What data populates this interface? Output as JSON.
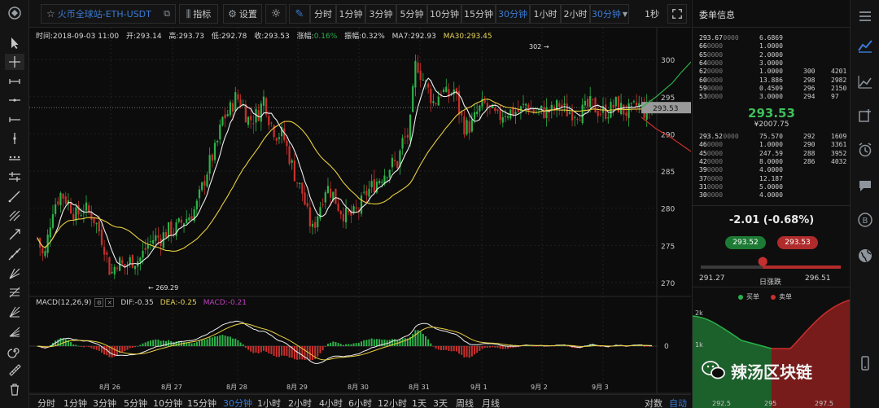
{
  "symbol": {
    "label": "火币全球站-ETH-USDT"
  },
  "toolbar": {
    "indicators": "指标",
    "settings": "设置",
    "timeframes": [
      "分时",
      "1分钟",
      "3分钟",
      "5分钟",
      "10分钟",
      "15分钟",
      "30分钟",
      "1小时",
      "2小时"
    ],
    "active_timeframe": "30分钟",
    "dropdown_value": "30分钟",
    "refresh": "1秒"
  },
  "info": {
    "time": "时间:2018-09-03 11:00",
    "open": "开:293.14",
    "high": "高:293.73",
    "low": "低:292.78",
    "close": "收:293.53",
    "change_label": "涨幅:",
    "change_value": "0.16%",
    "amplitude": "振幅:0.32%",
    "ma7": "MA7:292.93",
    "ma30": "MA30:293.45"
  },
  "macd_info": {
    "title": "MACD(12,26,9)",
    "dif": "DIF:-0.35",
    "dea": "DEA:-0.25",
    "macd": "MACD:-0.21"
  },
  "annotations": {
    "high_mark": "302",
    "low_mark": "269.29"
  },
  "y_axis": {
    "ticks": [
      "300",
      "295",
      "290",
      "285",
      "280",
      "275",
      "270"
    ],
    "macd_zero": "0",
    "price_tag": "293.53"
  },
  "x_axis": {
    "ticks": [
      "8月 26",
      "8月 27",
      "8月 28",
      "8月 29",
      "8月 30",
      "8月 31",
      "9月 1",
      "9月 2",
      "9月 3"
    ]
  },
  "bottom": {
    "timeframes": [
      "分时",
      "1分钟",
      "3分钟",
      "5分钟",
      "10分钟",
      "15分钟",
      "30分钟",
      "1小时",
      "2小时",
      "4小时",
      "6小时",
      "12小时",
      "1天",
      "3天",
      "周线",
      "月线"
    ],
    "active": "30分钟",
    "log": "对数",
    "auto": "自动"
  },
  "orderbook": {
    "title": "委单信息",
    "asks": [
      {
        "price": "293.67",
        "suffix": "0000",
        "amount": "6.6869",
        "t1": "",
        "t2": ""
      },
      {
        "price": "66",
        "suffix": "0000",
        "amount": "1.0000",
        "t1": "",
        "t2": ""
      },
      {
        "price": "65",
        "suffix": "0000",
        "amount": "2.0000",
        "t1": "",
        "t2": ""
      },
      {
        "price": "64",
        "suffix": "0000",
        "amount": "3.0000",
        "t1": "",
        "t2": ""
      },
      {
        "price": "62",
        "suffix": "0000",
        "amount": "1.0000",
        "t1": "300",
        "t2": "4201"
      },
      {
        "price": "60",
        "suffix": "0000",
        "amount": "13.886",
        "t1": "298",
        "t2": "2982"
      },
      {
        "price": "59",
        "suffix": "0000",
        "amount": "0.4509",
        "t1": "296",
        "t2": "2150"
      },
      {
        "price": "53",
        "suffix": "0000",
        "amount": "3.0000",
        "t1": "294",
        "t2": "97"
      }
    ],
    "last": "293.53",
    "last_cny": "¥2007.75",
    "bids": [
      {
        "price": "293.52",
        "suffix": "0000",
        "amount": "75.570",
        "t1": "292",
        "t2": "1609"
      },
      {
        "price": "46",
        "suffix": "0000",
        "amount": "1.0000",
        "t1": "290",
        "t2": "3361"
      },
      {
        "price": "45",
        "suffix": "0000",
        "amount": "247.59",
        "t1": "288",
        "t2": "3952"
      },
      {
        "price": "42",
        "suffix": "0000",
        "amount": "8.0000",
        "t1": "286",
        "t2": "4032"
      },
      {
        "price": "39",
        "suffix": "0000",
        "amount": "4.0000",
        "t1": "",
        "t2": ""
      },
      {
        "price": "37",
        "suffix": "0000",
        "amount": "12.187",
        "t1": "",
        "t2": ""
      },
      {
        "price": "31",
        "suffix": "0000",
        "amount": "5.0000",
        "t1": "",
        "t2": ""
      },
      {
        "price": "30",
        "suffix": "0000",
        "amount": "4.0000",
        "t1": "",
        "t2": ""
      }
    ]
  },
  "stats": {
    "change": "-2.01  (-0.68%)",
    "bid": "293.52",
    "ask": "293.53",
    "low": "291.27",
    "high": "296.51",
    "day_label": "日涨跌",
    "buy_legend": "买单",
    "sell_legend": "卖单",
    "depth_y": [
      "2k",
      "1k"
    ],
    "depth_x": [
      "292.5",
      "295",
      "297.5"
    ]
  },
  "watermark": "辣汤区块链",
  "colors": {
    "up": "#2db34a",
    "down": "#c9302c",
    "ma7": "#f0f0f0",
    "ma30": "#e8d040",
    "accent": "#3b7bd4"
  }
}
